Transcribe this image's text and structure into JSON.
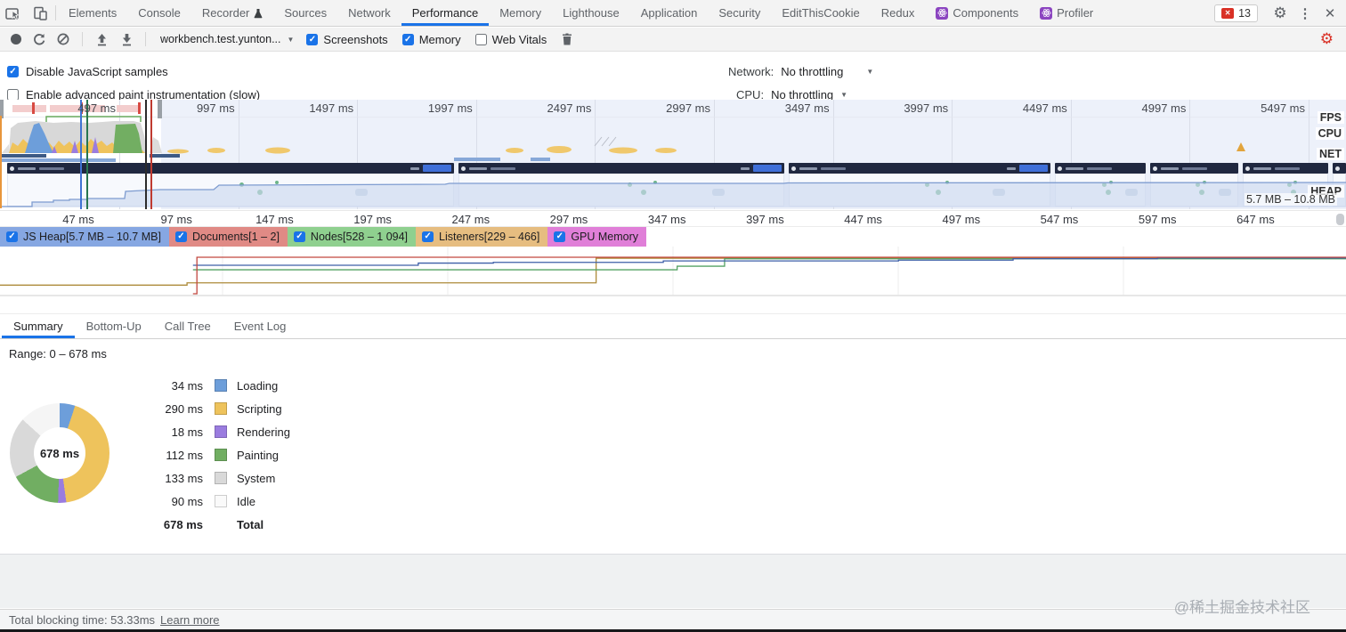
{
  "tabbar": {
    "tabs": [
      {
        "id": "elements",
        "label": "Elements"
      },
      {
        "id": "console",
        "label": "Console"
      },
      {
        "id": "recorder",
        "label": "Recorder",
        "icon": "flask-icon"
      },
      {
        "id": "sources",
        "label": "Sources"
      },
      {
        "id": "network",
        "label": "Network"
      },
      {
        "id": "performance",
        "label": "Performance",
        "active": true
      },
      {
        "id": "memory",
        "label": "Memory"
      },
      {
        "id": "lighthouse",
        "label": "Lighthouse"
      },
      {
        "id": "application",
        "label": "Application"
      },
      {
        "id": "security",
        "label": "Security"
      },
      {
        "id": "editthiscookie",
        "label": "EditThisCookie"
      },
      {
        "id": "redux",
        "label": "Redux"
      },
      {
        "id": "components",
        "label": "Components",
        "icon": "react-icon"
      },
      {
        "id": "profiler",
        "label": "Profiler",
        "icon": "react-icon"
      }
    ],
    "error_badge": {
      "count": "13",
      "color": "#d93025"
    }
  },
  "toolbar": {
    "page_select": {
      "value": "workbench.test.yunton...",
      "caret": "▼"
    },
    "checkboxes": [
      {
        "id": "screenshots",
        "label": "Screenshots",
        "checked": true
      },
      {
        "id": "memory",
        "label": "Memory",
        "checked": true
      },
      {
        "id": "web-vitals",
        "label": "Web Vitals",
        "checked": false
      }
    ]
  },
  "options": {
    "left": [
      {
        "id": "disable-js-samples",
        "label": "Disable JavaScript samples",
        "checked": true
      },
      {
        "id": "enable-paint-instrumentation",
        "label": "Enable advanced paint instrumentation (slow)",
        "checked": false
      }
    ],
    "network": {
      "label": "Network:",
      "value": "No throttling",
      "caret": "▼"
    },
    "cpu": {
      "label": "CPU:",
      "value": "No throttling",
      "caret": "▼"
    }
  },
  "overview": {
    "time_labels": [
      "497 ms",
      "997 ms",
      "1497 ms",
      "1997 ms",
      "2497 ms",
      "2997 ms",
      "3497 ms",
      "3997 ms",
      "4497 ms",
      "4997 ms",
      "5497 ms"
    ],
    "lane_labels": [
      "FPS",
      "CPU",
      "NET",
      "HEAP"
    ],
    "heap_range": "5.7 MB – 10.8 MB"
  },
  "ruler": {
    "labels": [
      "47 ms",
      "97 ms",
      "147 ms",
      "197 ms",
      "247 ms",
      "297 ms",
      "347 ms",
      "397 ms",
      "447 ms",
      "497 ms",
      "547 ms",
      "597 ms",
      "647 ms"
    ]
  },
  "counter_legend": [
    {
      "id": "js-heap",
      "label": "JS Heap[5.7 MB – 10.7 MB]",
      "checked": true,
      "bg": "#86a7e2"
    },
    {
      "id": "documents",
      "label": "Documents[1 – 2]",
      "checked": true,
      "bg": "#e08a85"
    },
    {
      "id": "nodes",
      "label": "Nodes[528 – 1 094]",
      "checked": true,
      "bg": "#8fd08f"
    },
    {
      "id": "listeners",
      "label": "Listeners[229 – 466]",
      "checked": true,
      "bg": "#e6bd80"
    },
    {
      "id": "gpu-memory",
      "label": "GPU Memory",
      "checked": true,
      "bg": "#e07fd8"
    }
  ],
  "chart_data": [
    {
      "id": "memory-counters",
      "type": "line",
      "x_unit": "ms",
      "x_range": [
        0,
        690
      ],
      "grid": "vertical",
      "series": [
        {
          "name": "Listeners",
          "color": "#ad8b3a",
          "unit": "count",
          "range": [
            229,
            466
          ],
          "points": [
            {
              "t": 7,
              "v": 285
            },
            {
              "t": 102,
              "v": 300
            },
            {
              "t": 309,
              "v": 460
            },
            {
              "t": 690,
              "v": 460
            }
          ]
        },
        {
          "name": "Nodes",
          "color": "#55a263",
          "unit": "count",
          "range": [
            528,
            1094
          ],
          "points": [
            {
              "t": 105,
              "v": 900
            },
            {
              "t": 350,
              "v": 955
            },
            {
              "t": 374,
              "v": 1070
            },
            {
              "t": 690,
              "v": 1070
            }
          ]
        },
        {
          "name": "JS Heap",
          "color": "#3d5fa8",
          "unit": "MB",
          "range": [
            5.7,
            10.7
          ],
          "points": [
            {
              "t": 105,
              "v": 9.6
            },
            {
              "t": 219,
              "v": 9.9
            },
            {
              "t": 257,
              "v": 10.0
            },
            {
              "t": 343,
              "v": 10.2
            },
            {
              "t": 462,
              "v": 10.3
            },
            {
              "t": 520,
              "v": 10.5
            },
            {
              "t": 593,
              "v": 10.6
            },
            {
              "t": 690,
              "v": 10.6
            }
          ]
        },
        {
          "name": "Documents",
          "color": "#c2473f",
          "unit": "count",
          "range": [
            1,
            2
          ],
          "points": [
            {
              "t": 105,
              "v": 1
            },
            {
              "t": 107,
              "v": 2
            },
            {
              "t": 690,
              "v": 2
            }
          ]
        }
      ]
    },
    {
      "id": "summary-donut",
      "type": "pie",
      "labels": [
        "Loading",
        "Scripting",
        "Rendering",
        "Painting",
        "System",
        "Idle"
      ],
      "values": [
        34,
        290,
        18,
        112,
        133,
        90
      ],
      "colors": [
        "#6d9eda",
        "#eec35c",
        "#9a7cdf",
        "#71ae62",
        "#d9d9d9",
        "#f5f5f5"
      ],
      "total": 678,
      "center_label": "678 ms"
    }
  ],
  "bottom_tabs": [
    {
      "id": "summary",
      "label": "Summary",
      "active": true
    },
    {
      "id": "bottom-up",
      "label": "Bottom-Up"
    },
    {
      "id": "call-tree",
      "label": "Call Tree"
    },
    {
      "id": "event-log",
      "label": "Event Log"
    }
  ],
  "summary": {
    "range_label": "Range: 0 – 678 ms",
    "rows": [
      {
        "value": "34 ms",
        "label": "Loading",
        "color": "#6d9eda"
      },
      {
        "value": "290 ms",
        "label": "Scripting",
        "color": "#eec35c"
      },
      {
        "value": "18 ms",
        "label": "Rendering",
        "color": "#9a7cdf"
      },
      {
        "value": "112 ms",
        "label": "Painting",
        "color": "#71ae62"
      },
      {
        "value": "133 ms",
        "label": "System",
        "color": "#d9d9d9"
      },
      {
        "value": "90 ms",
        "label": "Idle",
        "color": "#fafafa"
      }
    ],
    "total": {
      "value": "678 ms",
      "label": "Total"
    }
  },
  "statusbar": {
    "text": "Total blocking time: 53.33ms",
    "link": "Learn more"
  },
  "watermark": "@稀土掘金技术社区"
}
